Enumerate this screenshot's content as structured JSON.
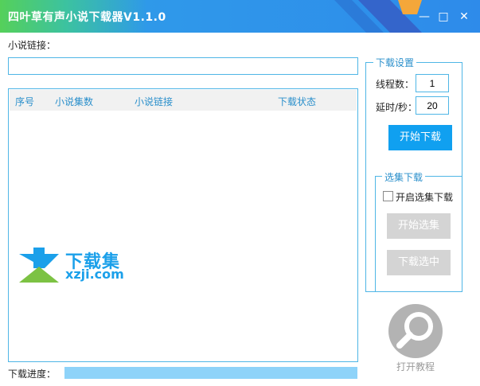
{
  "window": {
    "title": "四叶草有声小说下载器V1.1.0",
    "controls": {
      "minimize": "—",
      "maximize": "□",
      "close": "✕"
    }
  },
  "link": {
    "label": "小说链接：",
    "value": "",
    "placeholder": ""
  },
  "table": {
    "columns": [
      "序号",
      "小说集数",
      "小说链接",
      "下载状态"
    ],
    "rows": []
  },
  "progress": {
    "label": "下载进度：",
    "value": 1.0
  },
  "settings": {
    "title": "下载设置",
    "threads_label": "线程数：",
    "threads_value": "1",
    "delay_label": "延时/秒：",
    "delay_value": "20",
    "start_button": "开始下载"
  },
  "selection": {
    "title": "选集下载",
    "enable_label": "开启选集下载",
    "enabled": false,
    "start_select_button": "开始选集",
    "download_selected_button": "下载选中"
  },
  "help": {
    "label": "打开教程",
    "icon": "magnifier-icon"
  },
  "watermark": {
    "text": "下载集",
    "domain": "xzji.com"
  },
  "colors": {
    "accent": "#10a0f0",
    "border": "#4fb6e6",
    "header_text": "#2a8fcb",
    "progress": "#8ed3f9"
  }
}
